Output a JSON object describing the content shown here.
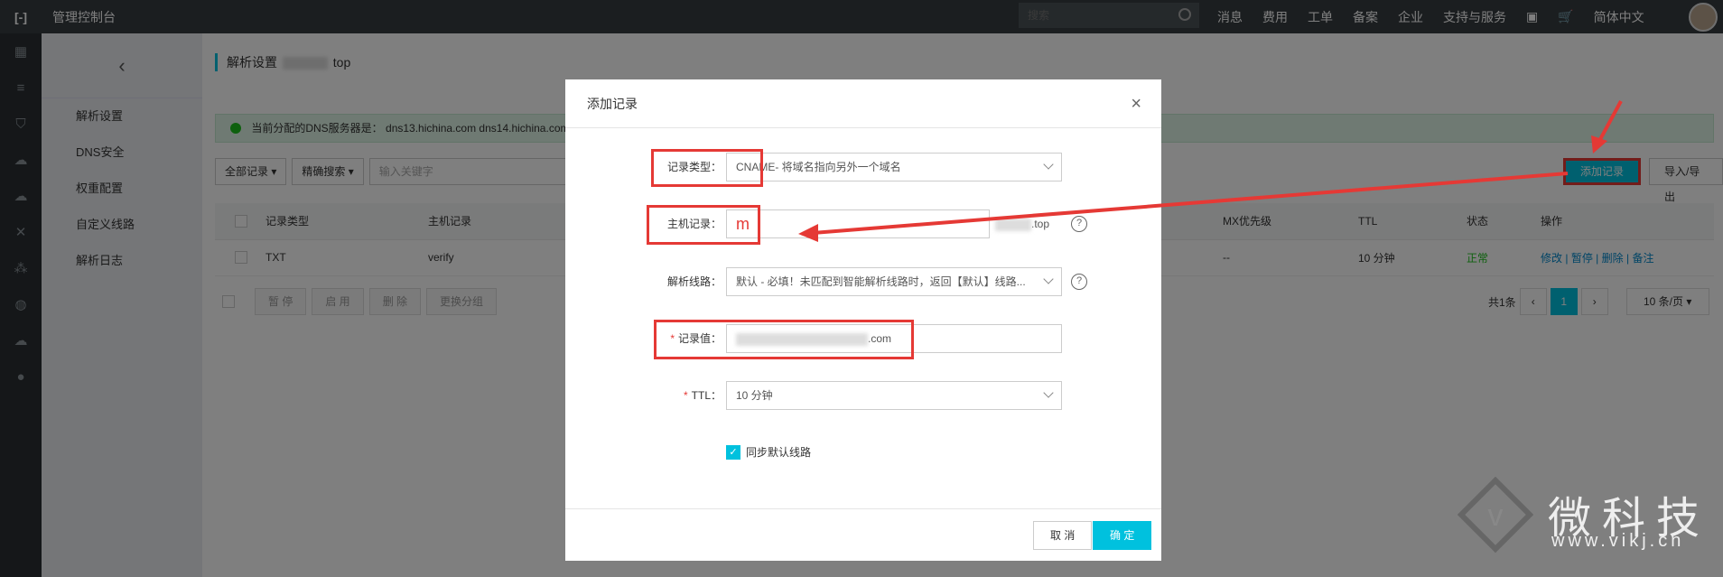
{
  "topbar": {
    "console": "管理控制台",
    "search_placeholder": "搜索",
    "nav": [
      "消息",
      "费用",
      "工单",
      "备案",
      "企业",
      "支持与服务",
      "简体中文"
    ]
  },
  "subnav": [
    "解析设置",
    "DNS安全",
    "权重配置",
    "自定义线路",
    "解析日志"
  ],
  "main": {
    "breadcrumb": "解析设置",
    "breadcrumb_domain": "top",
    "alert_label": "当前分配的DNS服务器是：",
    "alert_value": "dns13.hichina.com  dns14.hichina.com",
    "filter1": "全部记录",
    "filter2": "精确搜索",
    "keyword_placeholder": "输入关键字",
    "add_btn": "添加记录",
    "io_btn": "导入/导出",
    "columns": [
      "记录类型",
      "主机记录",
      "MX优先级",
      "TTL",
      "状态",
      "操作"
    ],
    "row": {
      "type": "TXT",
      "host": "verify",
      "mx": "--",
      "ttl": "10 分钟",
      "status": "正常",
      "ops": [
        "修改",
        "暂停",
        "删除",
        "备注"
      ]
    },
    "bulk": [
      "暂 停",
      "启 用",
      "删 除",
      "更换分组"
    ],
    "total": "共1条",
    "page": "1",
    "page_size": "10 条/页"
  },
  "dialog": {
    "title": "添加记录",
    "type_label": "记录类型：",
    "type_value": "CNAME- 将域名指向另外一个域名",
    "host_label": "主机记录：",
    "host_value": "m",
    "host_suffix": ".top",
    "line_label": "解析线路：",
    "line_value": "默认 - 必填！未匹配到智能解析线路时，返回【默认】线路...",
    "value_label": "记录值：",
    "value_suffix": ".com",
    "ttl_label": "TTL：",
    "ttl_value": "10 分钟",
    "sync_label": "同步默认线路",
    "cancel": "取 消",
    "ok": "确 定"
  },
  "watermark": {
    "text": "微科技",
    "url": "www.vikj.cn"
  },
  "colors": {
    "accent": "#00c1de",
    "highlight": "#e53935"
  }
}
